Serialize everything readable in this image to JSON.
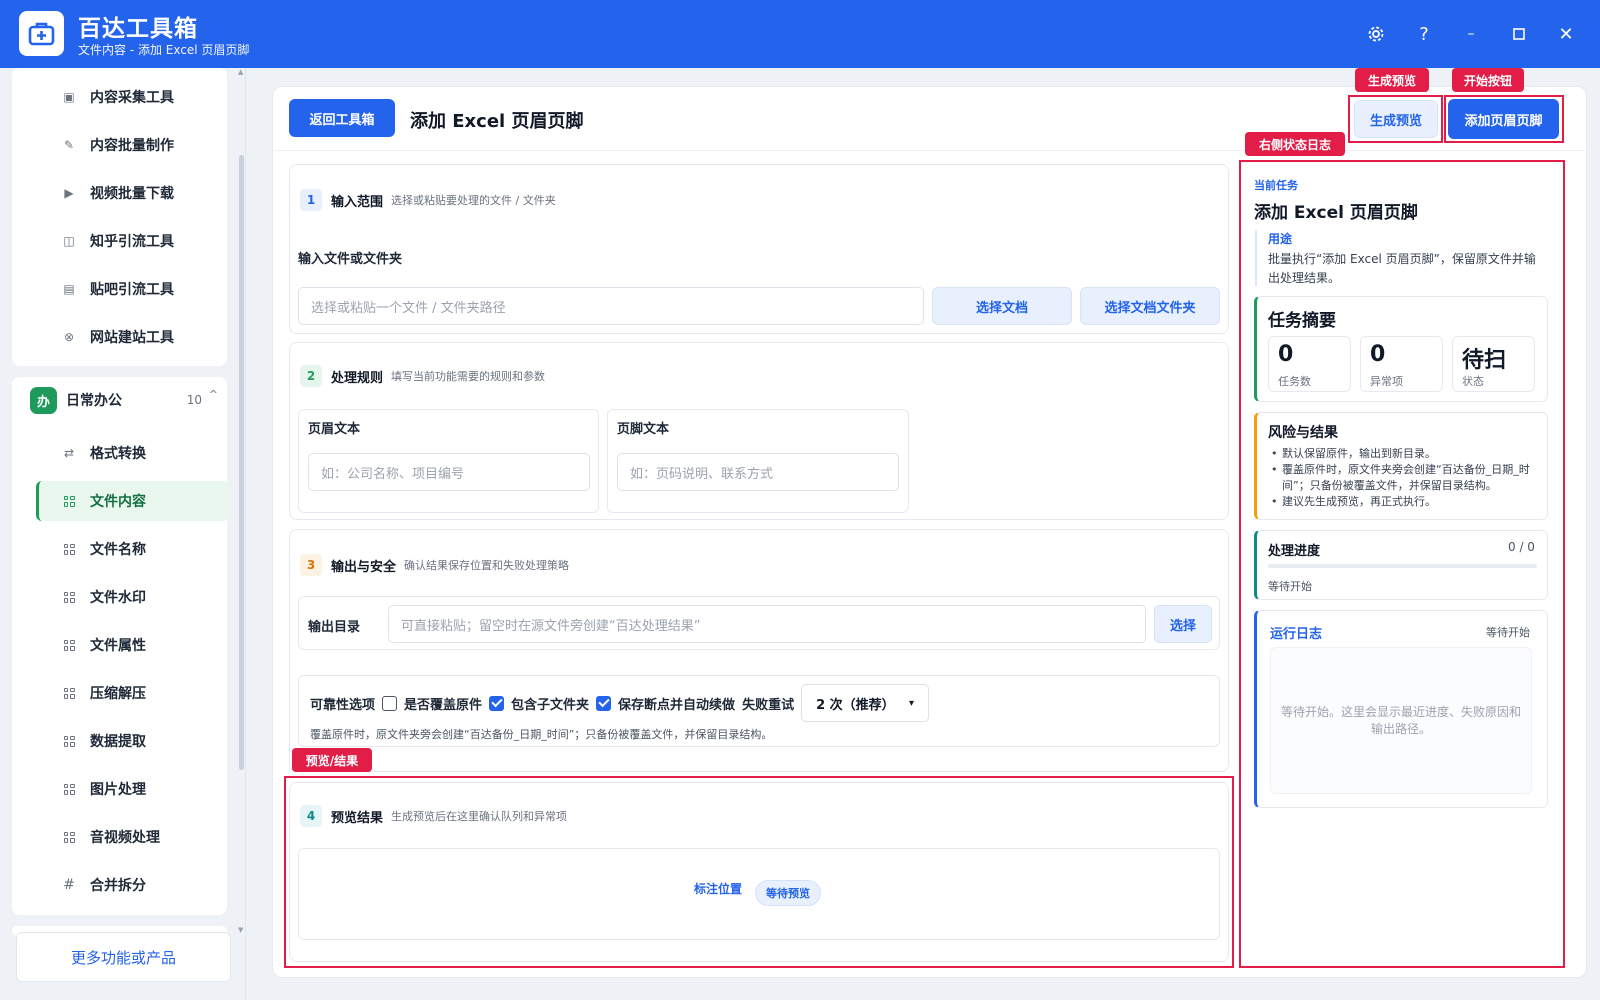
{
  "app": {
    "title": "百达工具箱",
    "subtitle": "文件内容 - 添加 Excel 页眉页脚"
  },
  "sidebar": {
    "top_items": [
      {
        "label": "内容采集工具"
      },
      {
        "label": "内容批量制作"
      },
      {
        "label": "视频批量下载"
      },
      {
        "label": "知乎引流工具"
      },
      {
        "label": "贴吧引流工具"
      },
      {
        "label": "网站建站工具"
      }
    ],
    "group": {
      "badge": "办",
      "title": "日常办公",
      "count": "10"
    },
    "group_items": [
      {
        "label": "格式转换"
      },
      {
        "label": "文件内容"
      },
      {
        "label": "文件名称"
      },
      {
        "label": "文件水印"
      },
      {
        "label": "文件属性"
      },
      {
        "label": "压缩解压"
      },
      {
        "label": "数据提取"
      },
      {
        "label": "图片处理"
      },
      {
        "label": "音视频处理"
      },
      {
        "label": "合并拆分"
      }
    ],
    "more_label": "更多功能或产品"
  },
  "header": {
    "back_label": "返回工具箱",
    "title": "添加 Excel 页眉页脚",
    "preview_label": "生成预览",
    "start_label": "添加页眉页脚"
  },
  "section1": {
    "num": "1",
    "title": "输入范围",
    "desc": "选择或粘贴要处理的文件 / 文件夹",
    "field_label": "输入文件或文件夹",
    "placeholder": "选择或粘贴一个文件 / 文件夹路径",
    "choose_doc": "选择文档",
    "choose_folder": "选择文档文件夹"
  },
  "section2": {
    "num": "2",
    "title": "处理规则",
    "desc": "填写当前功能需要的规则和参数",
    "header_label": "页眉文本",
    "header_placeholder": "如：公司名称、项目编号",
    "footer_label": "页脚文本",
    "footer_placeholder": "如：页码说明、联系方式"
  },
  "section3": {
    "num": "3",
    "title": "输出与安全",
    "desc": "确认结果保存位置和失败处理策略",
    "output_label": "输出目录",
    "output_placeholder": "可直接粘贴；留空时在源文件旁创建“百达处理结果”",
    "choose_label": "选择",
    "reliability_label": "可靠性选项",
    "overwrite_label": "是否覆盖原件",
    "subfolder_label": "包含子文件夹",
    "resume_label": "保存断点并自动续做",
    "retry_label": "失败重试",
    "retry_value": "2 次（推荐）",
    "note": "覆盖原件时，原文件夹旁会创建“百达备份_日期_时间”；只备份被覆盖文件，并保留目录结构。"
  },
  "section4": {
    "num": "4",
    "title": "预览结果",
    "desc": "生成预览后在这里确认队列和异常项",
    "mark_label": "标注位置",
    "status_pill": "等待预览"
  },
  "annotations": {
    "preview": "生成预览",
    "start": "开始按钮",
    "status_log": "右侧状态日志",
    "preview_result": "预览/结果"
  },
  "status": {
    "current_task_label": "当前任务",
    "current_task_title": "添加 Excel 页眉页脚",
    "usage_label": "用途",
    "usage_text": "批量执行“添加 Excel 页眉页脚”，保留原文件并输出处理结果。",
    "summary_title": "任务摘要",
    "stats": [
      {
        "value": "0",
        "label": "任务数"
      },
      {
        "value": "0",
        "label": "异常项"
      },
      {
        "value": "待扫",
        "label": "状态"
      }
    ],
    "risk_title": "风险与结果",
    "risks": [
      "默认保留原件，输出到新目录。",
      "覆盖原件时，原文件夹旁会创建“百达备份_日期_时间”；只备份被覆盖文件，并保留目录结构。",
      "建议先生成预览，再正式执行。"
    ],
    "progress_title": "处理进度",
    "progress_count": "0 / 0",
    "progress_fraction": 0,
    "progress_state": "等待开始",
    "log_title": "运行日志",
    "log_state": "等待开始",
    "log_empty": "等待开始。这里会显示最近进度、失败原因和输出路径。"
  },
  "colors": {
    "brand": "#2463eb",
    "office_green": "#1e9a5b",
    "annotation_red": "#e11d48"
  }
}
